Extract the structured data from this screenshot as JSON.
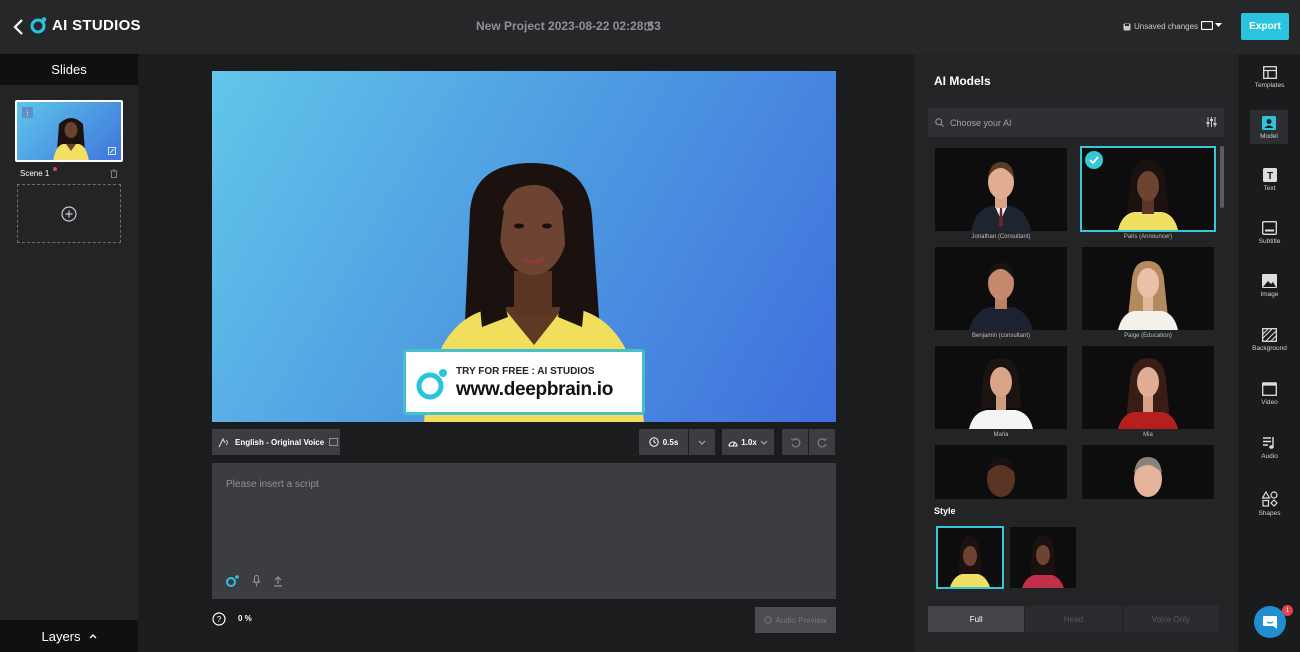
{
  "app": {
    "logo_text": "AI STUDIOS",
    "project_title": "New Project 2023-08-22 02:28:53",
    "unsaved": "Unsaved changes",
    "export_label": "Export"
  },
  "left_panel": {
    "slides_title": "Slides",
    "scene_label": "Scene 1",
    "layers_label": "Layers"
  },
  "canvas": {
    "banner_small": "TRY FOR FREE : AI STUDIOS",
    "banner_big": "www.deepbrain.io"
  },
  "controls": {
    "voice_label": "English - Original Voice",
    "pause_label": "0.5s",
    "speed_label": "1.0x"
  },
  "script": {
    "placeholder": "Please insert a script",
    "progress": "0 %",
    "audio_preview": "Audio Preview"
  },
  "models_panel": {
    "title": "AI Models",
    "search_placeholder": "Choose your AI",
    "models": [
      {
        "name": "Jonathan (Consultant)"
      },
      {
        "name": "Paris (Announcer)"
      },
      {
        "name": "Benjamin (consultant)"
      },
      {
        "name": "Paige (Education)"
      },
      {
        "name": "Maria"
      },
      {
        "name": "Mia"
      }
    ],
    "style_title": "Style",
    "segments": [
      "Full",
      "Head",
      "Voice Only"
    ]
  },
  "rail": {
    "items": [
      {
        "label": "Templates",
        "icon": "templates-icon"
      },
      {
        "label": "Model",
        "icon": "model-icon"
      },
      {
        "label": "Text",
        "icon": "text-icon"
      },
      {
        "label": "Subtitle",
        "icon": "subtitle-icon"
      },
      {
        "label": "Image",
        "icon": "image-icon"
      },
      {
        "label": "Background",
        "icon": "background-icon"
      },
      {
        "label": "Video",
        "icon": "video-icon"
      },
      {
        "label": "Audio",
        "icon": "audio-icon"
      },
      {
        "label": "Shapes",
        "icon": "shapes-icon"
      }
    ]
  },
  "chat": {
    "badge": "1"
  },
  "colors": {
    "accent": "#2bc4df",
    "selection": "#36c8d6"
  }
}
